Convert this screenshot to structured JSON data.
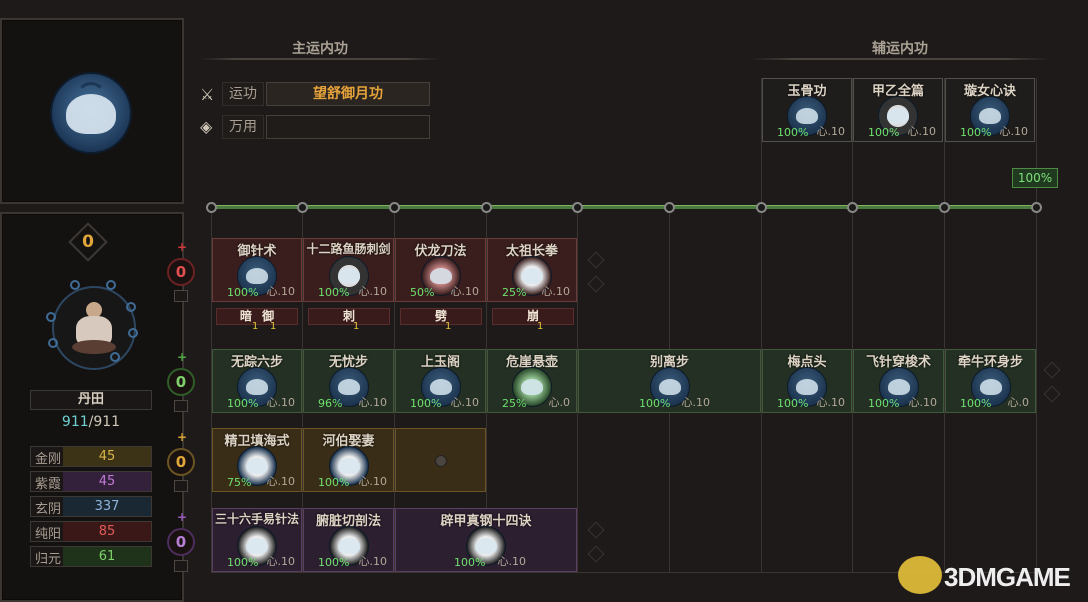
{
  "main_section_title": "主运内功",
  "aux_section_title": "辅运内功",
  "yungong": {
    "label": "运功",
    "value": "望舒御月功"
  },
  "wanyong": {
    "label": "万用",
    "value": ""
  },
  "aux_percent": "100%",
  "aux_skills": [
    {
      "name": "玉骨功",
      "pct": "100%",
      "xin": "心.10"
    },
    {
      "name": "甲乙全篇",
      "pct": "100%",
      "xin": "心.10"
    },
    {
      "name": "璇女心诀",
      "pct": "100%",
      "xin": "心.10"
    }
  ],
  "left": {
    "level": "0",
    "dantian_label": "丹田",
    "dantian_value": "911",
    "dantian_sep": "/",
    "dantian_max": "911"
  },
  "stats": [
    {
      "label": "金刚",
      "value": "45",
      "color": "#d8b44a"
    },
    {
      "label": "紫霞",
      "value": "45",
      "color": "#c07ad6"
    },
    {
      "label": "玄阴",
      "value": "337",
      "color": "#8fb3d8"
    },
    {
      "label": "纯阳",
      "value": "85",
      "color": "#e05a5a"
    },
    {
      "label": "归元",
      "value": "61",
      "color": "#7fd06a"
    }
  ],
  "row_counters": [
    {
      "plus": "+",
      "value": "0",
      "color": "#d03a3a"
    },
    {
      "plus": "+",
      "value": "0",
      "color": "#4faa45"
    },
    {
      "plus": "+",
      "value": "0",
      "color": "#d6a535"
    },
    {
      "plus": "+",
      "value": "0",
      "color": "#9a5cc0"
    }
  ],
  "row1": [
    {
      "name": "御针术",
      "pct": "100%",
      "xin": "心.10"
    },
    {
      "name": "十二路鱼肠刺剑",
      "pct": "100%",
      "xin": "心.10"
    },
    {
      "name": "伏龙刀法",
      "pct": "50%",
      "xin": "心.10"
    },
    {
      "name": "太祖长拳",
      "pct": "25%",
      "xin": "心.10"
    }
  ],
  "row1_tags": [
    {
      "text": "暗",
      "n": "1",
      "text2": "御",
      "n2": "1"
    },
    {
      "text": "刺",
      "n": "1"
    },
    {
      "text": "劈",
      "n": "1"
    },
    {
      "text": "崩",
      "n": "1"
    }
  ],
  "row2": [
    {
      "name": "无踪六步",
      "pct": "100%",
      "xin": "心.10"
    },
    {
      "name": "无忧步",
      "pct": "96%",
      "xin": "心.10"
    },
    {
      "name": "上玉阁",
      "pct": "100%",
      "xin": "心.10"
    },
    {
      "name": "危崖悬壶",
      "pct": "25%",
      "xin": "心.0"
    },
    {
      "name": "别离步",
      "pct": "100%",
      "xin": "心.10"
    },
    {
      "name": "梅点头",
      "pct": "100%",
      "xin": "心.10"
    },
    {
      "name": "飞针穿梭术",
      "pct": "100%",
      "xin": "心.10"
    },
    {
      "name": "牵牛环身步",
      "pct": "100%",
      "xin": "心.0"
    }
  ],
  "row3": [
    {
      "name": "精卫填海式",
      "pct": "75%",
      "xin": "心.10"
    },
    {
      "name": "河伯娶妻",
      "pct": "100%",
      "xin": "心.10"
    }
  ],
  "row4": [
    {
      "name": "三十六手易针法",
      "pct": "100%",
      "xin": "心.10"
    },
    {
      "name": "腑脏切剖法",
      "pct": "100%",
      "xin": "心.10"
    },
    {
      "name": "辟甲真钢十四诀",
      "pct": "100%",
      "xin": "心.10"
    }
  ],
  "watermark": "3DMGAME"
}
